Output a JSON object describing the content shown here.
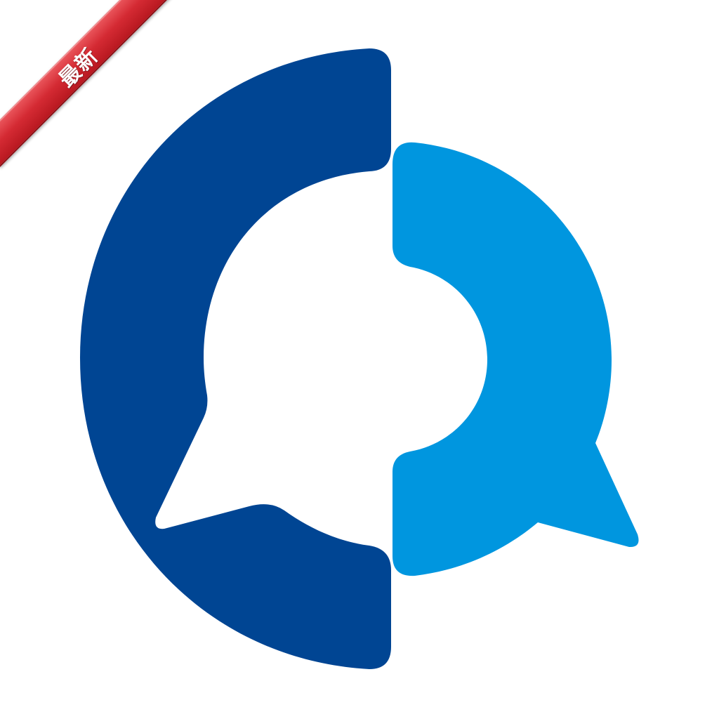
{
  "ribbon": {
    "label": "最新",
    "color": "#d42a33"
  },
  "logo": {
    "icon": "speech-bubble-logo-icon",
    "dark_color": "#004593",
    "light_color": "#0096df",
    "background": "#ffffff"
  }
}
